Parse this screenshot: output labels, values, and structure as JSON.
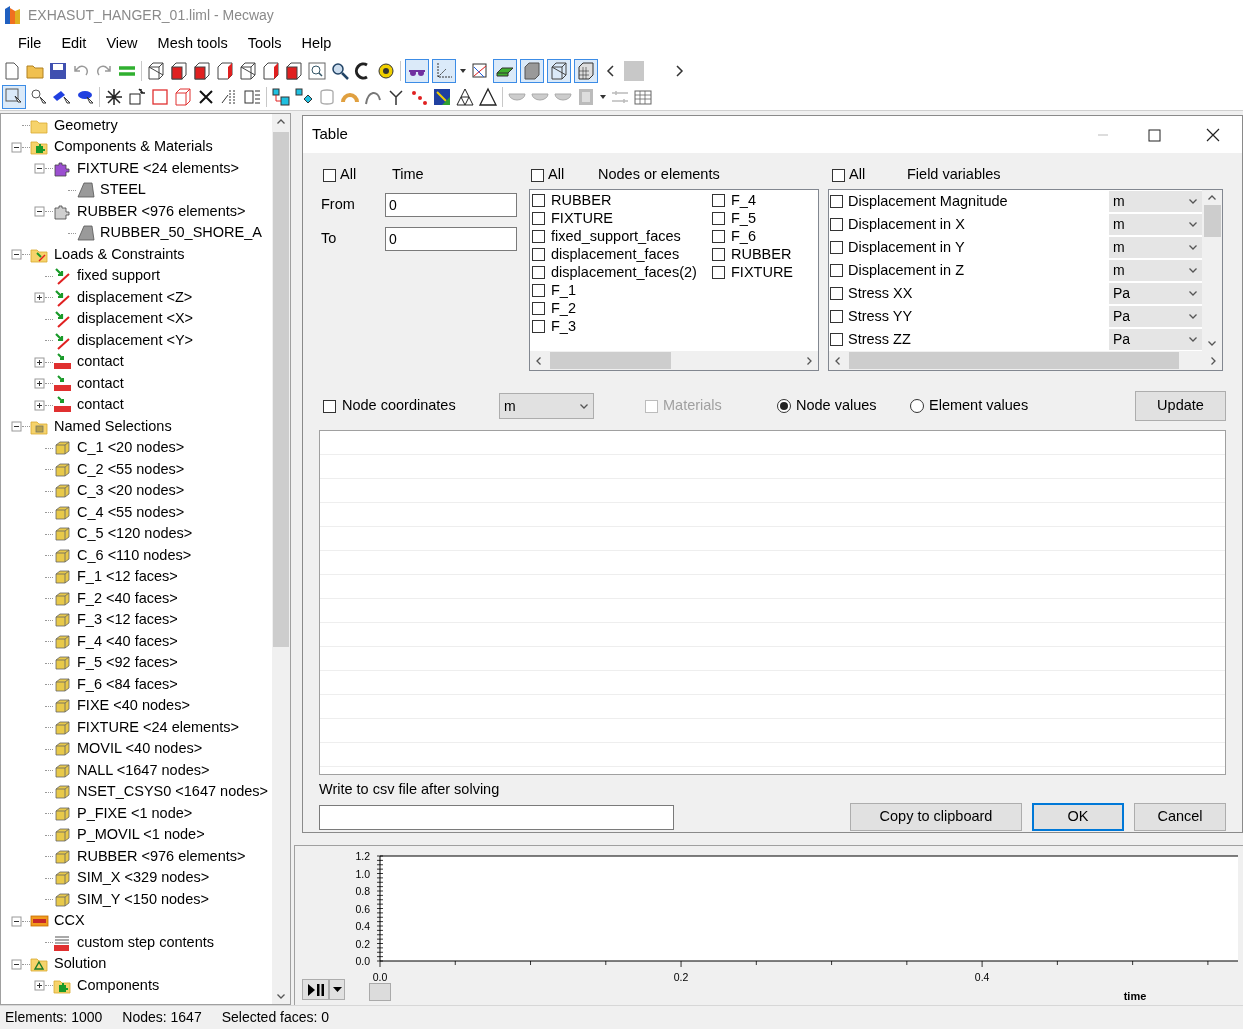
{
  "window": {
    "title": "EXHASUT_HANGER_01.liml - Mecway"
  },
  "menu": [
    "File",
    "Edit",
    "View",
    "Mesh tools",
    "Tools",
    "Help"
  ],
  "tree": [
    {
      "label": "Geometry",
      "kind": "folder"
    },
    {
      "label": "Components & Materials",
      "kind": "components-folder",
      "expanded": true,
      "children": [
        {
          "label": "FIXTURE <24 elements>",
          "kind": "component",
          "color": "#9b4fd0",
          "expanded": true,
          "children": [
            {
              "label": "STEEL",
              "kind": "material"
            }
          ]
        },
        {
          "label": "RUBBER <976 elements>",
          "kind": "component",
          "color": "#cfcfcf",
          "expanded": true,
          "children": [
            {
              "label": "RUBBER_50_SHORE_A",
              "kind": "material"
            }
          ]
        }
      ]
    },
    {
      "label": "Loads & Constraints",
      "kind": "loads-folder",
      "expanded": true,
      "children": [
        {
          "label": "fixed support",
          "kind": "load"
        },
        {
          "label": "displacement <Z>",
          "kind": "load",
          "expanded": false
        },
        {
          "label": "displacement <X>",
          "kind": "load"
        },
        {
          "label": "displacement <Y>",
          "kind": "load"
        },
        {
          "label": "contact",
          "kind": "contact",
          "expanded": false
        },
        {
          "label": "contact",
          "kind": "contact",
          "expanded": false
        },
        {
          "label": "contact",
          "kind": "contact",
          "expanded": false
        }
      ]
    },
    {
      "label": "Named Selections",
      "kind": "selections-folder",
      "expanded": true,
      "children": [
        {
          "label": "C_1 <20 nodes>",
          "kind": "selection"
        },
        {
          "label": "C_2 <55 nodes>",
          "kind": "selection"
        },
        {
          "label": "C_3 <20 nodes>",
          "kind": "selection"
        },
        {
          "label": "C_4 <55 nodes>",
          "kind": "selection"
        },
        {
          "label": "C_5 <120 nodes>",
          "kind": "selection"
        },
        {
          "label": "C_6 <110 nodes>",
          "kind": "selection"
        },
        {
          "label": "F_1 <12 faces>",
          "kind": "selection"
        },
        {
          "label": "F_2 <40 faces>",
          "kind": "selection"
        },
        {
          "label": "F_3 <12 faces>",
          "kind": "selection"
        },
        {
          "label": "F_4 <40 faces>",
          "kind": "selection"
        },
        {
          "label": "F_5 <92 faces>",
          "kind": "selection"
        },
        {
          "label": "F_6 <84 faces>",
          "kind": "selection"
        },
        {
          "label": "FIXE <40 nodes>",
          "kind": "selection"
        },
        {
          "label": "FIXTURE <24 elements>",
          "kind": "selection"
        },
        {
          "label": "MOVIL <40 nodes>",
          "kind": "selection"
        },
        {
          "label": "NALL <1647 nodes>",
          "kind": "selection"
        },
        {
          "label": "NSET_CSYS0 <1647 nodes>",
          "kind": "selection"
        },
        {
          "label": "P_FIXE <1 node>",
          "kind": "selection"
        },
        {
          "label": "P_MOVIL <1 node>",
          "kind": "selection"
        },
        {
          "label": "RUBBER <976 elements>",
          "kind": "selection"
        },
        {
          "label": "SIM_X <329 nodes>",
          "kind": "selection"
        },
        {
          "label": "SIM_Y <150 nodes>",
          "kind": "selection"
        }
      ]
    },
    {
      "label": "CCX",
      "kind": "ccx",
      "expanded": true,
      "children": [
        {
          "label": "custom step contents",
          "kind": "custom"
        }
      ]
    },
    {
      "label": "Solution",
      "kind": "solution",
      "expanded": true,
      "children": [
        {
          "label": "Components",
          "kind": "components-folder",
          "expanded": false
        }
      ]
    }
  ],
  "dialog": {
    "title": "Table",
    "time": {
      "all_label": "All",
      "all_checked": false,
      "heading": "Time",
      "from_label": "From",
      "from_value": "0",
      "to_label": "To",
      "to_value": "0"
    },
    "nodes": {
      "all_label": "All",
      "all_checked": false,
      "heading": "Nodes or elements",
      "items": [
        {
          "label": "RUBBER",
          "checked": false
        },
        {
          "label": "FIXTURE",
          "checked": false
        },
        {
          "label": "fixed_support_faces",
          "checked": false
        },
        {
          "label": "displacement_faces",
          "checked": false
        },
        {
          "label": "displacement_faces(2)",
          "checked": false
        },
        {
          "label": "F_1",
          "checked": false
        },
        {
          "label": "F_2",
          "checked": false
        },
        {
          "label": "F_3",
          "checked": false
        },
        {
          "label": "F_4",
          "checked": false
        },
        {
          "label": "F_5",
          "checked": false
        },
        {
          "label": "F_6",
          "checked": false
        },
        {
          "label": "RUBBER",
          "checked": false
        },
        {
          "label": "FIXTURE",
          "checked": false
        }
      ]
    },
    "fields": {
      "all_label": "All",
      "all_checked": false,
      "heading": "Field variables",
      "items": [
        {
          "label": "Displacement Magnitude",
          "checked": false,
          "unit": "m"
        },
        {
          "label": "Displacement in X",
          "checked": false,
          "unit": "m"
        },
        {
          "label": "Displacement in Y",
          "checked": false,
          "unit": "m"
        },
        {
          "label": "Displacement in Z",
          "checked": false,
          "unit": "m"
        },
        {
          "label": "Stress XX",
          "checked": false,
          "unit": "Pa"
        },
        {
          "label": "Stress YY",
          "checked": false,
          "unit": "Pa"
        },
        {
          "label": "Stress ZZ",
          "checked": false,
          "unit": "Pa"
        }
      ]
    },
    "node_coordinates": {
      "label": "Node coordinates",
      "checked": false,
      "unit": "m"
    },
    "materials": {
      "label": "Materials",
      "checked": false,
      "disabled": true
    },
    "value_modes": [
      {
        "label": "Node values",
        "selected": true
      },
      {
        "label": "Element values",
        "selected": false
      }
    ],
    "update_button": "Update",
    "csv_label": "Write to csv file after solving",
    "buttons": [
      {
        "label": "Copy to clipboard",
        "default": false
      },
      {
        "label": "OK",
        "default": true
      },
      {
        "label": "Cancel",
        "default": false
      }
    ]
  },
  "chart": {
    "chart_data": {
      "type": "line",
      "xlabel": "time",
      "xlim": [
        0,
        0.57
      ],
      "ylim": [
        0,
        1.2
      ],
      "xticks": [
        {
          "value": 0,
          "label": "0.0"
        },
        0.2,
        0.4
      ],
      "yticks": [
        {
          "value": 0,
          "label": "0.0"
        },
        0.2,
        0.4,
        0.6,
        0.8,
        {
          "value": 1,
          "label": "1.0"
        },
        1.2
      ]
    }
  },
  "status_bar": [
    "Elements: 1000",
    "Nodes: 1647",
    "Selected faces: 0"
  ]
}
